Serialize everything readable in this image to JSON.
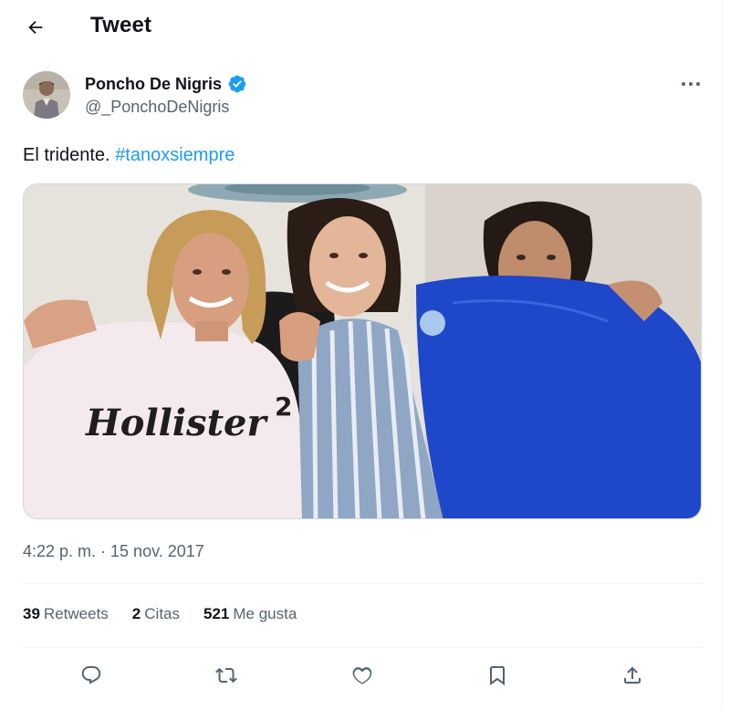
{
  "header": {
    "title": "Tweet"
  },
  "author": {
    "display_name": "Poncho De Nigris",
    "handle": "@_PonchoDeNigris",
    "verified": true
  },
  "tweet": {
    "text_plain": "El tridente. ",
    "hashtag": "#tanoxsiempre",
    "media_shirt_text": "Hollister",
    "media_shirt_number": "2"
  },
  "timestamp": "4:22 p. m. · 15 nov. 2017",
  "stats": {
    "retweets": {
      "count": "39",
      "label": "Retweets"
    },
    "quotes": {
      "count": "2",
      "label": "Citas"
    },
    "likes": {
      "count": "521",
      "label": "Me gusta"
    }
  },
  "icons": [
    "back-arrow-icon",
    "verified-badge-icon",
    "more-icon",
    "reply-icon",
    "retweet-icon",
    "like-icon",
    "bookmark-icon",
    "share-icon"
  ],
  "colors": {
    "accent": "#1d9bf0",
    "text": "#0f1419",
    "secondary": "#536471",
    "divider": "#eff3f4"
  }
}
